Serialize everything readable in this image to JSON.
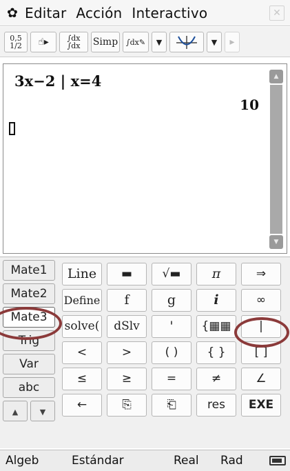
{
  "menubar": {
    "settings_icon": "gear-icon",
    "items": [
      "Editar",
      "Acción",
      "Interactivo"
    ],
    "close_icon": "close-icon"
  },
  "toolbar": {
    "buttons": [
      "0.5 ↔ 1/2",
      "↯▸",
      "∫dx ∫dx",
      "Simp",
      "∫dx✎",
      "▼",
      "⟂graph",
      "▼",
      "▸"
    ],
    "simp_label": "Simp",
    "toggle_label_top": "0,5",
    "toggle_label_bottom": "1/2"
  },
  "workarea": {
    "input_expression": "3x−2 | x=4",
    "result": "10"
  },
  "keyboard": {
    "tabs": [
      "Mate1",
      "Mate2",
      "Mate3",
      "Trig",
      "Var",
      "abc"
    ],
    "active_tab": "Mate3",
    "nav_up": "▲",
    "nav_down": "▼",
    "keys": [
      [
        "Line",
        "▬",
        "√▬",
        "π",
        "⇒"
      ],
      [
        "Define",
        "f",
        "g",
        "i",
        "∞"
      ],
      [
        "solve(",
        "dSlv",
        "'",
        "{▦▦",
        "|"
      ],
      [
        "<",
        ">",
        "( )",
        "{ }",
        "[ ]"
      ],
      [
        "≤",
        "≥",
        "=",
        "≠",
        "∠"
      ],
      [
        "←",
        "⎘",
        "⎗",
        "res",
        "EXE"
      ]
    ]
  },
  "statusbar": {
    "mode": "Algeb",
    "format": "Estándar",
    "number": "Real",
    "angle": "Rad"
  },
  "colors": {
    "annotation": "#8b3a3a"
  }
}
